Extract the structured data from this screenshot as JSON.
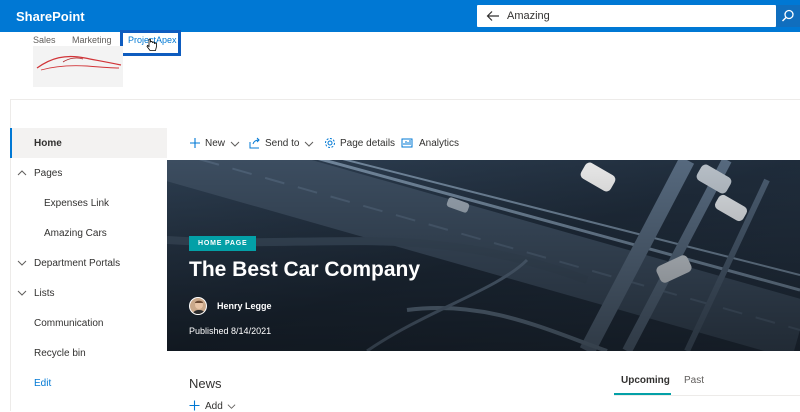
{
  "suite": {
    "brand": "SharePoint",
    "search_value": "Amazing"
  },
  "hub": {
    "links": [
      "Sales",
      "Marketing",
      "ProjectApex"
    ],
    "active": "ProjectApex"
  },
  "leftnav": {
    "items": [
      {
        "label": "Home"
      },
      {
        "label": "Pages"
      },
      {
        "label": "Expenses Link"
      },
      {
        "label": "Amazing Cars"
      },
      {
        "label": "Department Portals"
      },
      {
        "label": "Lists"
      },
      {
        "label": "Communication"
      },
      {
        "label": "Recycle bin"
      },
      {
        "label": "Edit"
      }
    ]
  },
  "commandbar": {
    "new": "New",
    "send_to": "Send to",
    "page_details": "Page details",
    "analytics": "Analytics"
  },
  "hero": {
    "badge": "HOME PAGE",
    "title": "The Best Car Company",
    "author": "Henry Legge",
    "published_label": "Published",
    "published_date": "8/14/2021"
  },
  "news": {
    "title": "News",
    "add": "Add"
  },
  "events": {
    "tabs": [
      "Upcoming",
      "Past"
    ]
  },
  "colors": {
    "suite_bar": "#0078d4",
    "accent_teal": "#03a0a7",
    "highlight_box": "#0e5cbf"
  }
}
